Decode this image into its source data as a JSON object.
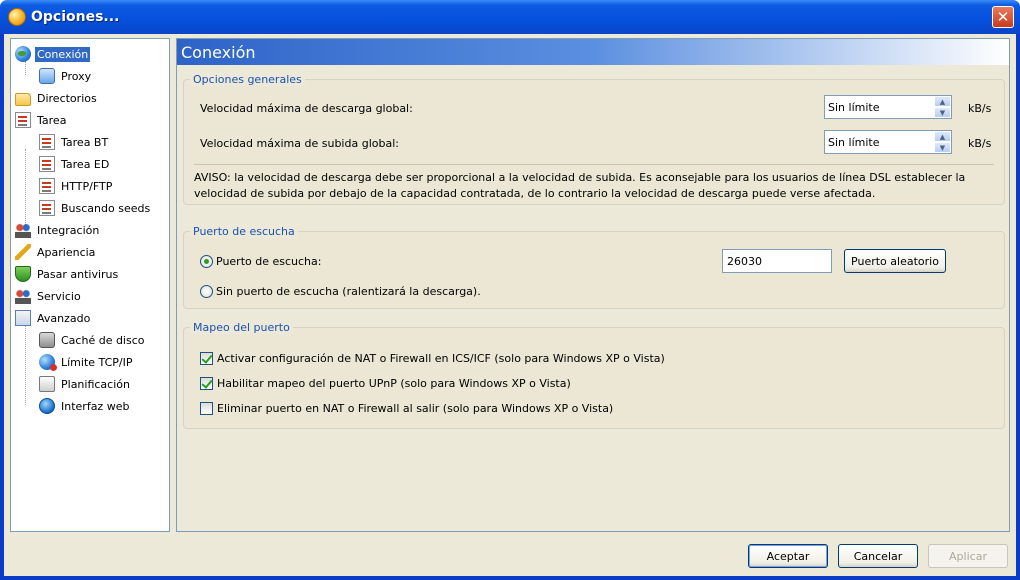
{
  "window": {
    "title": "Opciones..."
  },
  "tree": {
    "items": [
      {
        "label": "Conexión",
        "icon": "globe-icon",
        "level": 0,
        "selected": true
      },
      {
        "label": "Proxy",
        "icon": "proxy-icon",
        "level": 1
      },
      {
        "label": "Directorios",
        "icon": "folder-icon",
        "level": 0
      },
      {
        "label": "Tarea",
        "icon": "task-icon",
        "level": 0
      },
      {
        "label": "Tarea BT",
        "icon": "task-icon",
        "level": 1
      },
      {
        "label": "Tarea ED",
        "icon": "task-icon",
        "level": 1
      },
      {
        "label": "HTTP/FTP",
        "icon": "task-icon",
        "level": 1
      },
      {
        "label": "Buscando seeds",
        "icon": "task-icon",
        "level": 1
      },
      {
        "label": "Integración",
        "icon": "people-icon",
        "level": 0
      },
      {
        "label": "Apariencia",
        "icon": "brush-icon",
        "level": 0
      },
      {
        "label": "Pasar antivirus",
        "icon": "shield-icon",
        "level": 0
      },
      {
        "label": "Servicio",
        "icon": "people-icon",
        "level": 0
      },
      {
        "label": "Avanzado",
        "icon": "advanced-icon",
        "level": 0
      },
      {
        "label": "Caché de disco",
        "icon": "disk-icon",
        "level": 1
      },
      {
        "label": "Límite TCP/IP",
        "icon": "network-icon",
        "level": 1
      },
      {
        "label": "Planificación",
        "icon": "schedule-icon",
        "level": 1
      },
      {
        "label": "Interfaz web",
        "icon": "web-icon",
        "level": 1
      }
    ]
  },
  "panel": {
    "title": "Conexión",
    "general": {
      "legend": "Opciones generales",
      "download_label": "Velocidad máxima de descarga global:",
      "download_value": "Sin límite",
      "upload_label": "Velocidad máxima de subida global:",
      "upload_value": "Sin límite",
      "unit": "kB/s",
      "warning": "AVISO: la velocidad de descarga debe ser proporcional a la velocidad de subida. Es aconsejable para los usuarios de línea DSL establecer la velocidad de subida por debajo de la capacidad contratada, de lo contrario la velocidad de descarga puede verse afectada."
    },
    "listen": {
      "legend": "Puerto de escucha",
      "port_option": "Puerto de escucha:",
      "port_value": "26030",
      "random_button": "Puerto aleatorio",
      "no_port_option": "Sin puerto de escucha (ralentizará la descarga)."
    },
    "mapping": {
      "legend": "Mapeo del puerto",
      "nat_option": "Activar configuración de NAT o Firewall en ICS/ICF (solo para Windows XP o Vista)",
      "upnp_option": "Habilitar mapeo del puerto UPnP (solo para Windows XP o Vista)",
      "remove_option": "Eliminar puerto en NAT o Firewall al salir (solo para Windows XP o Vista)",
      "nat_checked": true,
      "upnp_checked": true,
      "remove_checked": false
    }
  },
  "footer": {
    "accept": "Aceptar",
    "cancel": "Cancelar",
    "apply": "Aplicar"
  },
  "colors": {
    "titlebar": "#0550dc",
    "selection": "#316ac5",
    "legend_text": "#1c4fb5"
  }
}
